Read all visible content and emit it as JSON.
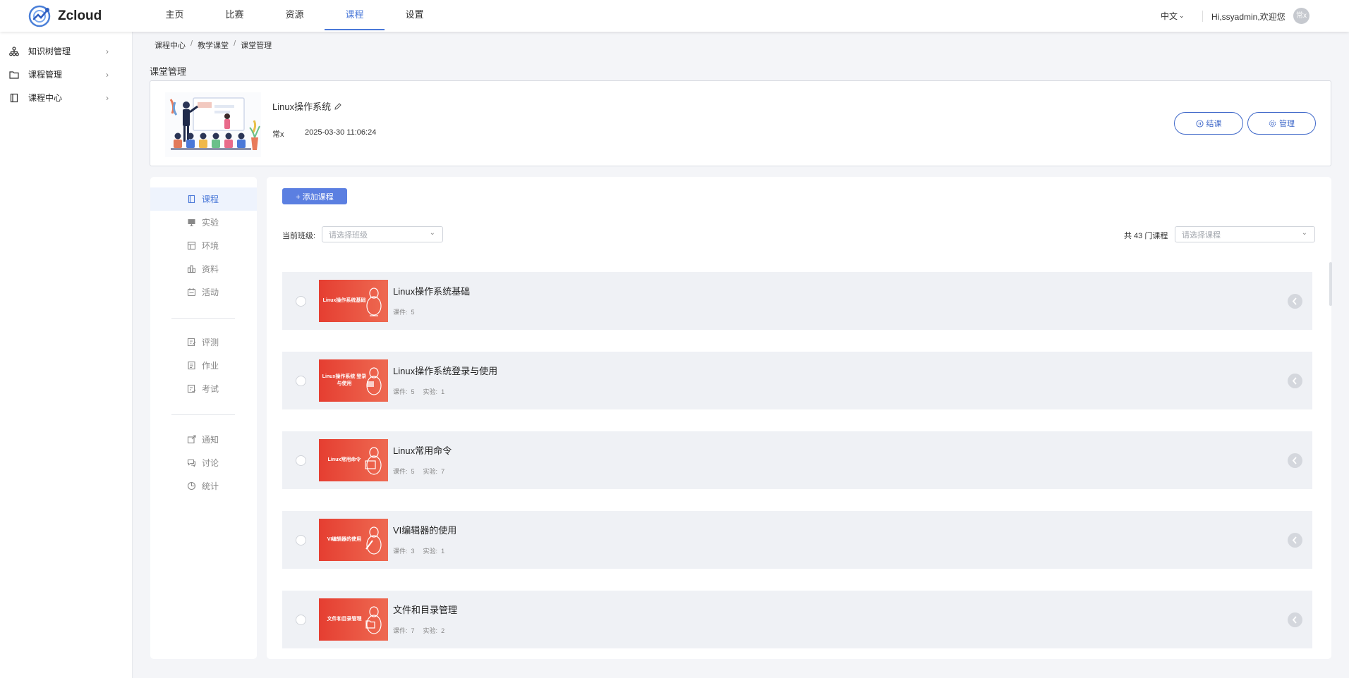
{
  "header": {
    "app_name": "Zcloud",
    "nav": [
      {
        "label": "主页",
        "active": false
      },
      {
        "label": "比赛",
        "active": false
      },
      {
        "label": "资源",
        "active": false
      },
      {
        "label": "课程",
        "active": true
      },
      {
        "label": "设置",
        "active": false
      }
    ],
    "language": "中文",
    "greeting": "Hi,ssyadmin,欢迎您",
    "avatar_text": "常x",
    "accent_color": "#4a78d8"
  },
  "sidebar": {
    "items": [
      {
        "label": "知识树管理",
        "icon": "tree-icon"
      },
      {
        "label": "课程管理",
        "icon": "folder-icon"
      },
      {
        "label": "课程中心",
        "icon": "book-icon"
      }
    ]
  },
  "breadcrumb": [
    "课程中心",
    "教学课堂",
    "课堂管理"
  ],
  "page_title": "课堂管理",
  "class_info": {
    "name": "Linux操作系统",
    "teacher": "常x",
    "created_at": "2025-03-30 11:06:24",
    "end_button": "结课",
    "manage_button": "管理"
  },
  "inner_menu": {
    "group1": [
      {
        "label": "课程",
        "icon": "course-icon",
        "active": true
      },
      {
        "label": "实验",
        "icon": "monitor-icon",
        "active": false
      },
      {
        "label": "环境",
        "icon": "environment-icon",
        "active": false
      },
      {
        "label": "资料",
        "icon": "materials-icon",
        "active": false
      },
      {
        "label": "活动",
        "icon": "activity-icon",
        "active": false
      }
    ],
    "group2": [
      {
        "label": "评测",
        "icon": "assessment-icon",
        "active": false
      },
      {
        "label": "作业",
        "icon": "homework-icon",
        "active": false
      },
      {
        "label": "考试",
        "icon": "exam-icon",
        "active": false
      }
    ],
    "group3": [
      {
        "label": "通知",
        "icon": "notice-icon",
        "active": false
      },
      {
        "label": "讨论",
        "icon": "discussion-icon",
        "active": false
      },
      {
        "label": "统计",
        "icon": "statistics-icon",
        "active": false
      }
    ]
  },
  "main": {
    "add_course_button": "+ 添加课程",
    "class_filter_label": "当前班级:",
    "class_filter_placeholder": "请选择班级",
    "course_count_label": "共 43 门课程",
    "course_filter_placeholder": "请选择课程",
    "courses": [
      {
        "title": "Linux操作系统基础",
        "thumb_text": "Linux操作系统基础",
        "meta": [
          {
            "k": "课件:",
            "v": "5"
          }
        ]
      },
      {
        "title": "Linux操作系统登录与使用",
        "thumb_text": "Linux操作系统 登录与使用",
        "meta": [
          {
            "k": "课件:",
            "v": "5"
          },
          {
            "k": "实验:",
            "v": "1"
          }
        ]
      },
      {
        "title": "Linux常用命令",
        "thumb_text": "Linux常用命令",
        "meta": [
          {
            "k": "课件:",
            "v": "5"
          },
          {
            "k": "实验:",
            "v": "7"
          }
        ]
      },
      {
        "title": "VI编辑器的使用",
        "thumb_text": "VI编辑器的使用",
        "meta": [
          {
            "k": "课件:",
            "v": "3"
          },
          {
            "k": "实验:",
            "v": "1"
          }
        ]
      },
      {
        "title": "文件和目录管理",
        "thumb_text": "文件和目录管理",
        "meta": [
          {
            "k": "课件:",
            "v": "7"
          },
          {
            "k": "实验:",
            "v": "2"
          }
        ]
      }
    ]
  }
}
